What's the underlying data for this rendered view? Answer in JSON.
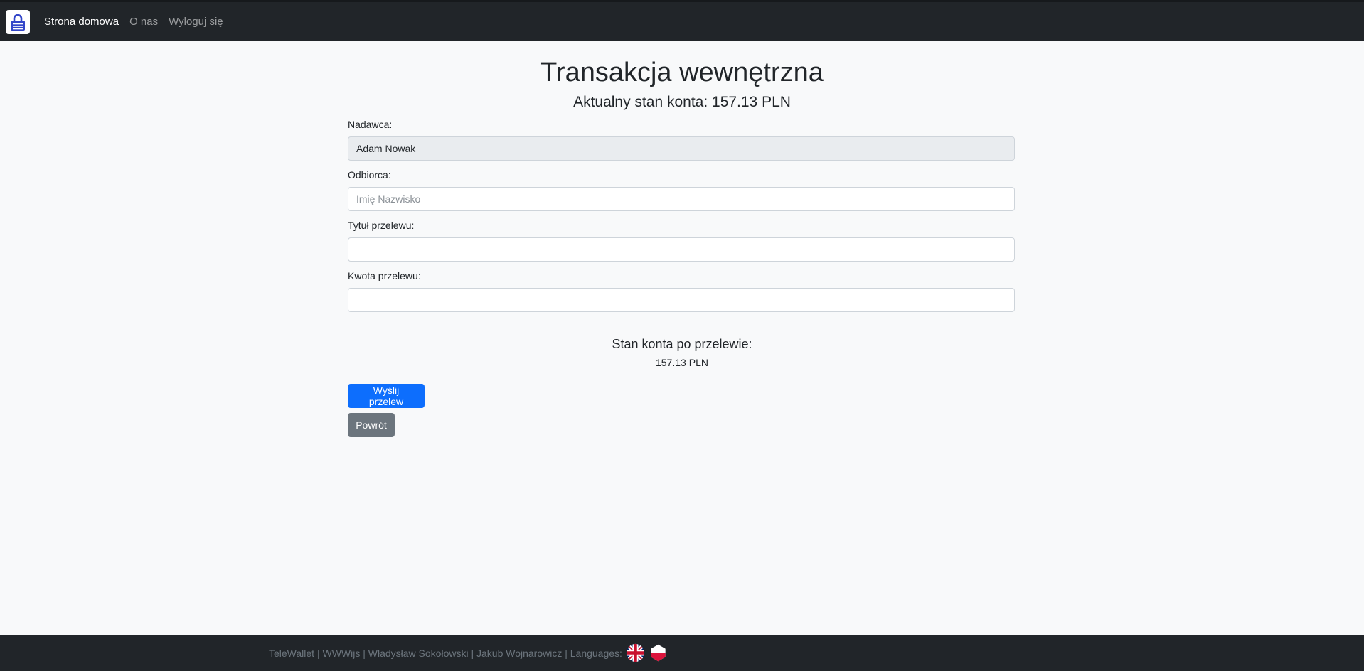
{
  "navbar": {
    "brand_icon": "padlock-wallet-icon",
    "brand_color": "#3346c9",
    "links": [
      {
        "label": "Strona domowa",
        "active": true
      },
      {
        "label": "O nas",
        "active": false
      },
      {
        "label": "Wyloguj się",
        "active": false
      }
    ]
  },
  "page": {
    "title": "Transakcja wewnętrzna",
    "balance_text": "Aktualny stan konta: 157.13 PLN"
  },
  "form": {
    "sender_label": "Nadawca:",
    "sender_value": "Adam Nowak",
    "recipient_label": "Odbiorca:",
    "recipient_placeholder": "Imię Nazwisko",
    "recipient_value": "",
    "title_label": "Tytuł przelewu:",
    "title_value": "",
    "amount_label": "Kwota przelewu:",
    "amount_value": ""
  },
  "after_transfer": {
    "label": "Stan konta po przelewie:",
    "value": "157.13 PLN"
  },
  "buttons": {
    "send_label": "Wyślij przelew",
    "back_label": "Powrót",
    "primary_color": "#0d6efd",
    "secondary_color": "#6c757d"
  },
  "footer": {
    "text": "TeleWallet | WWWijs | Władysław Sokołowski | Jakub Wojnarowicz | Languages:",
    "flags": [
      "uk-flag-icon",
      "poland-flag-icon"
    ]
  }
}
